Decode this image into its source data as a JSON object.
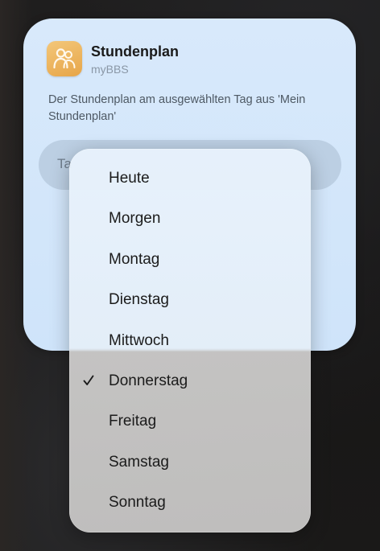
{
  "widget": {
    "app_name": "Stundenplan",
    "app_subtitle": "myBBS",
    "description": "Der Stundenplan am ausgewählten Tag aus 'Mein Stundenplan'",
    "parameter_label_partial": "Ta",
    "icon": "people-icon",
    "accent_color": "#e7a548"
  },
  "menu": {
    "items": [
      {
        "label": "Heute",
        "selected": false
      },
      {
        "label": "Morgen",
        "selected": false
      },
      {
        "label": "Montag",
        "selected": false
      },
      {
        "label": "Dienstag",
        "selected": false
      },
      {
        "label": "Mittwoch",
        "selected": false
      },
      {
        "label": "Donnerstag",
        "selected": true
      },
      {
        "label": "Freitag",
        "selected": false
      },
      {
        "label": "Samstag",
        "selected": false
      },
      {
        "label": "Sonntag",
        "selected": false
      }
    ],
    "check_icon": "checkmark-icon"
  }
}
